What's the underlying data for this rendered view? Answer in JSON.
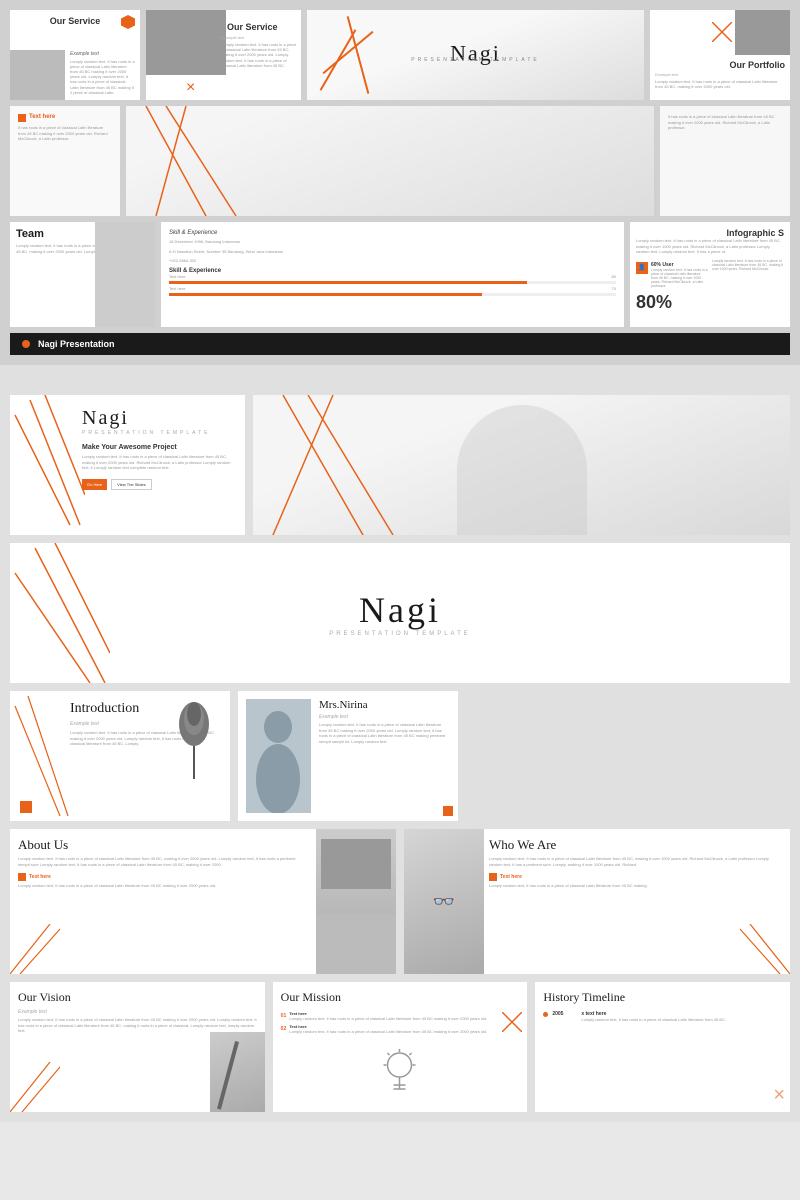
{
  "app": {
    "title": "Nagi Presentation Template"
  },
  "top": {
    "row1": {
      "slide1": {
        "title": "Our Service",
        "example_label": "Example text",
        "body": "Lomply random text. It has roots in a piece of classical Latin literature from 45 BC making it over 2000 years old. Lomply random text, it has roots in a piece of classical Latin literature from 45 BC making it 2 piece of classical Latin."
      },
      "slide2": {
        "title": "Our Service",
        "example_label": "Example text",
        "body": "Lomply random text. It has roots in a piece of classical Latin literature from 45 BC, making it over 2000 years old. Lomply random text, it has roots in a piece of classical Latin literature from 45 BC."
      },
      "hero": {
        "title": "Nagi",
        "subtitle": "Presentation Template"
      },
      "slide4": {
        "title": "Our Portfolio",
        "example_label": "Example text",
        "body": "Lomply random text. It has roots in a piece of classical Latin literature from 45 BC, making it over 2000 years old."
      }
    },
    "row2": {
      "left_text": "It has roots in a piece of classical Latin literature from 45 BC making it over 2000 years old. Richard McClinock, a Latin professor.",
      "right_text": "It has roots in a piece of classical Latin literature from 45 BC making it over 2000 years old. Richard McClinock, a Latin professor."
    },
    "row3": {
      "slide_team": {
        "title": "Team",
        "body": "Lomply random text, it has roots in a piece of classical Latin literature from 45 BC, making it over 2000 years old. Lomply in a piece of classical."
      },
      "slide_exp": {
        "date": "18 December 1996, Bandung Indonesia",
        "address": "A.H Nasution Street, Number 35 Bandung, West Java Indonesia",
        "phone": "+022-5964-320",
        "skills_title": "Skill & Experience",
        "skill1": "Text here",
        "skill2": "Text here",
        "skill1_val": "80",
        "skill2_val": "70"
      },
      "slide_infographic": {
        "title": "Infographic S",
        "example_label": "Example text",
        "body1": "Lomply random text. It has roots in a piece of classical Latin literature from 45 BC, making it over 1000 years old. Richard McClinock, a Latin professor Lomply random text. Lomply random text. It has a piece of.",
        "stat1_label": "60% User",
        "stat1_body": "Lomply random text. It has roots in a piece of classical Latin literature from 45 BC, making it over 1000 years. Richard McClinock, a Latin professor.",
        "stat2_body": "Lomply random text. It has roots in a piece of classical Latin literature from 45 BC. making it over 1000 years. Richard McClinock.",
        "big_percent": "80%"
      }
    },
    "bottom_bar": {
      "label": "Nagi Presentation"
    }
  },
  "bottom": {
    "row1": {
      "slide_nagi": {
        "title": "Nagi",
        "subtitle": "Presentation Template",
        "tagline": "Make Your Awesome Project",
        "body": "Lomply random text. It has roots in a piece of classical Latin literature from 45 BC, making it over 2000 years old. Richard McClinock, a Latin professor Lomply random text, it Lomply random text complete random text.",
        "btn1": "Go Here",
        "btn2": "View The Slides"
      }
    },
    "row2": {
      "slide_nagi_big": {
        "title": "Nagi",
        "subtitle": "Presentation Template"
      }
    },
    "row3": {
      "slide_intro": {
        "title": "Introduction",
        "label": "Example text",
        "body": "Lomply random text. It has roots in a piece of classical Latin literature from 45 BC making it over 2000 years old. Lomply random text, it has roots in a piece of classical literature from 45 BC. Lomply."
      },
      "slide_nirina": {
        "name": "Mrs.Nirina",
        "example_label": "Example text",
        "body": "Lomply random text, it has roots in a piece of classical Latin literature from 45 BC making it over 2000 years old. Lomply random text, it has roots in a piece of classical Latin literature from 45 BC making pertinent sempit sampit lot. Lomply random text."
      }
    },
    "row4": {
      "slide_about": {
        "title": "About Us",
        "body": "Lomply random text. It has roots in a piece of classical Latin literature from 45 BC, making it over 2000 years old. Lomply random text, it has roots a pertinent sempit sore Lomply random text. It has roots in a piece of classical Latin literature from 45 BC, making it over 2000.",
        "text_here": "Text here",
        "text_here_body": "Lomply random text, it has roots in a piece of classical Latin literature from 45 BC making it over 2000 years old."
      },
      "slide_who": {
        "title": "Who We Are",
        "body": "Lomply random text. It has roots in a piece of classical Latin literature from 45 BC, making it over 1000 years old. Richard McClinock, a Latin professor Lomply random text, it has a pertinent sore. Lomply, making it over 1000 years old. Richard.",
        "text_here": "Text here",
        "text_here_body": "Lomply random text, it has roots in a piece of classical Latin literature from 45 BC making."
      }
    },
    "row5": {
      "slide_vision": {
        "title": "Our Vision",
        "label": "Example text",
        "body": "Lomply random text, it has roots in a piece of classical Latin literature from 45 BC making it over 2000 years old. Lomply random text, it has roots in a piece of classical Latin literature from 45 BC. making it roots in a piece of classical. Lomply random text, lomply random text."
      },
      "slide_mission": {
        "title": "Our Mission",
        "item1_num": "01",
        "item1_label": "Text here",
        "item1_body": "Lomply random text, it has roots in a piece of classical Latin literature from 45 BC making it over 2000 years old.",
        "item2_num": "02",
        "item2_label": "Text here",
        "item2_body": "Lomply random text, it has roots in a piece of classical Latin literature from 45 BC making it over 2000 years old."
      },
      "slide_history": {
        "title": "History Timeline",
        "item1_year": "2005",
        "item1_text": "x text here",
        "item1_body": "Lomply random text, it has roots in a piece of classical Latin literature from 45 BC."
      }
    }
  }
}
